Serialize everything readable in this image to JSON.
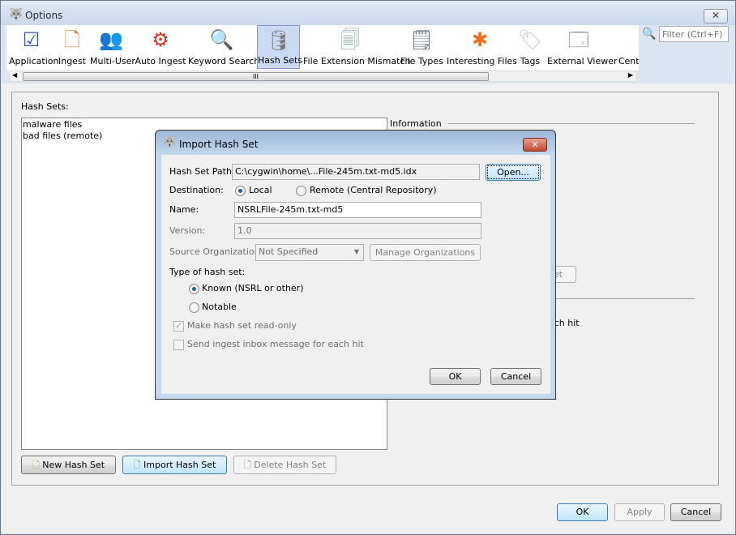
{
  "window": {
    "title": "Options",
    "close_icon": "close-icon"
  },
  "toolbar": {
    "items": [
      {
        "label": "Application",
        "icon": "application-check-icon"
      },
      {
        "label": "Ingest",
        "icon": "ingest-icon"
      },
      {
        "label": "Multi-User",
        "icon": "users-icon"
      },
      {
        "label": "Auto Ingest",
        "icon": "gears-icon"
      },
      {
        "label": "Keyword Search",
        "icon": "magnifier-icon"
      },
      {
        "label": "Hash Sets",
        "icon": "database-icon",
        "selected": true
      },
      {
        "label": "File Extension Mismatch",
        "icon": "documents-icon"
      },
      {
        "label": "File Types",
        "icon": "file-question-icon"
      },
      {
        "label": "Interesting Files",
        "icon": "asterisk-icon"
      },
      {
        "label": "Tags",
        "icon": "tag-icon"
      },
      {
        "label": "External Viewer",
        "icon": "window-icon"
      },
      {
        "label": "Centr",
        "icon": ""
      }
    ],
    "filter_placeholder": "Filter (Ctrl+F)",
    "scroll_grip": "III"
  },
  "hash_sets": {
    "label": "Hash Sets:",
    "items": [
      "malware files",
      "bad files (remote)"
    ],
    "information_label": "Information",
    "partial_button": "et",
    "partial_text": "ach hit",
    "new_button": "New Hash Set",
    "import_button": "Import Hash Set",
    "delete_button": "Delete Hash Set"
  },
  "footer": {
    "ok": "OK",
    "apply": "Apply",
    "cancel": "Cancel"
  },
  "dialog": {
    "title": "Import Hash Set",
    "path_label": "Hash Set Path:",
    "path_value": "C:\\cygwin\\home\\...File-245m.txt-md5.idx",
    "open_button": "Open...",
    "destination_label": "Destination:",
    "dest_local": "Local",
    "dest_remote": "Remote (Central Repository)",
    "destination_selected": "Local",
    "name_label": "Name:",
    "name_value": "NSRLFile-245m.txt-md5",
    "version_label": "Version:",
    "version_value": "1.0",
    "source_org_label": "Source Organization:",
    "source_org_value": "Not Specified",
    "manage_button": "Manage Organizations",
    "type_label": "Type of hash set:",
    "type_known": "Known (NSRL or other)",
    "type_notable": "Notable",
    "type_selected": "Known (NSRL or other)",
    "readonly_label": "Make hash set read-only",
    "readonly_checked": true,
    "inbox_label": "Send ingest inbox message for each hit",
    "inbox_checked": false,
    "ok": "OK",
    "cancel": "Cancel"
  }
}
